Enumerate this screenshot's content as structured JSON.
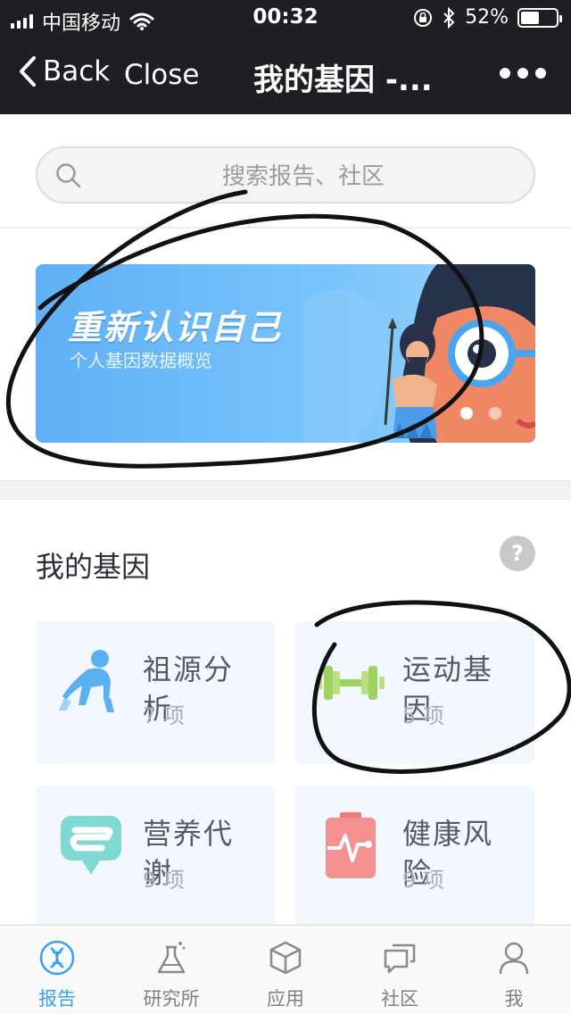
{
  "status_bar": {
    "carrier": "中国移动",
    "time": "00:32",
    "battery_percent": "52%",
    "battery_level": 0.52,
    "icons": [
      "signal-icon",
      "wifi-icon",
      "rotation-lock-icon",
      "bluetooth-icon",
      "battery-icon"
    ]
  },
  "nav": {
    "back_label": "Back",
    "close_label": "Close",
    "title": "我的基因 -...",
    "more_icon": "more-dots-icon"
  },
  "search": {
    "placeholder": "搜索报告、社区",
    "icon": "search-icon"
  },
  "banner": {
    "title": "重新认识自己",
    "subtitle": "个人基因数据概览",
    "slides": 2,
    "active_slide": 1
  },
  "genes": {
    "section_title": "我的基因",
    "help_label": "?",
    "cards": [
      {
        "name": "祖源分析",
        "count": "7 项",
        "icon": "monkey-icon"
      },
      {
        "name": "运动基因",
        "count": "5 项",
        "icon": "dumbbell-icon"
      },
      {
        "name": "营养代谢",
        "count": "9 项",
        "icon": "intestine-icon"
      },
      {
        "name": "健康风险",
        "count": "9 项",
        "icon": "heartbeat-clipboard-icon"
      }
    ]
  },
  "tabs": [
    {
      "label": "报告",
      "icon": "dna-icon",
      "active": true
    },
    {
      "label": "研究所",
      "icon": "flask-icon",
      "active": false
    },
    {
      "label": "应用",
      "icon": "cube-icon",
      "active": false
    },
    {
      "label": "社区",
      "icon": "chat-icon",
      "active": false
    },
    {
      "label": "我",
      "icon": "person-icon",
      "active": false
    }
  ],
  "colors": {
    "nav_bg": "#1e1f22",
    "accent": "#3aa0f0",
    "card_bg": "#f2f8fd"
  }
}
